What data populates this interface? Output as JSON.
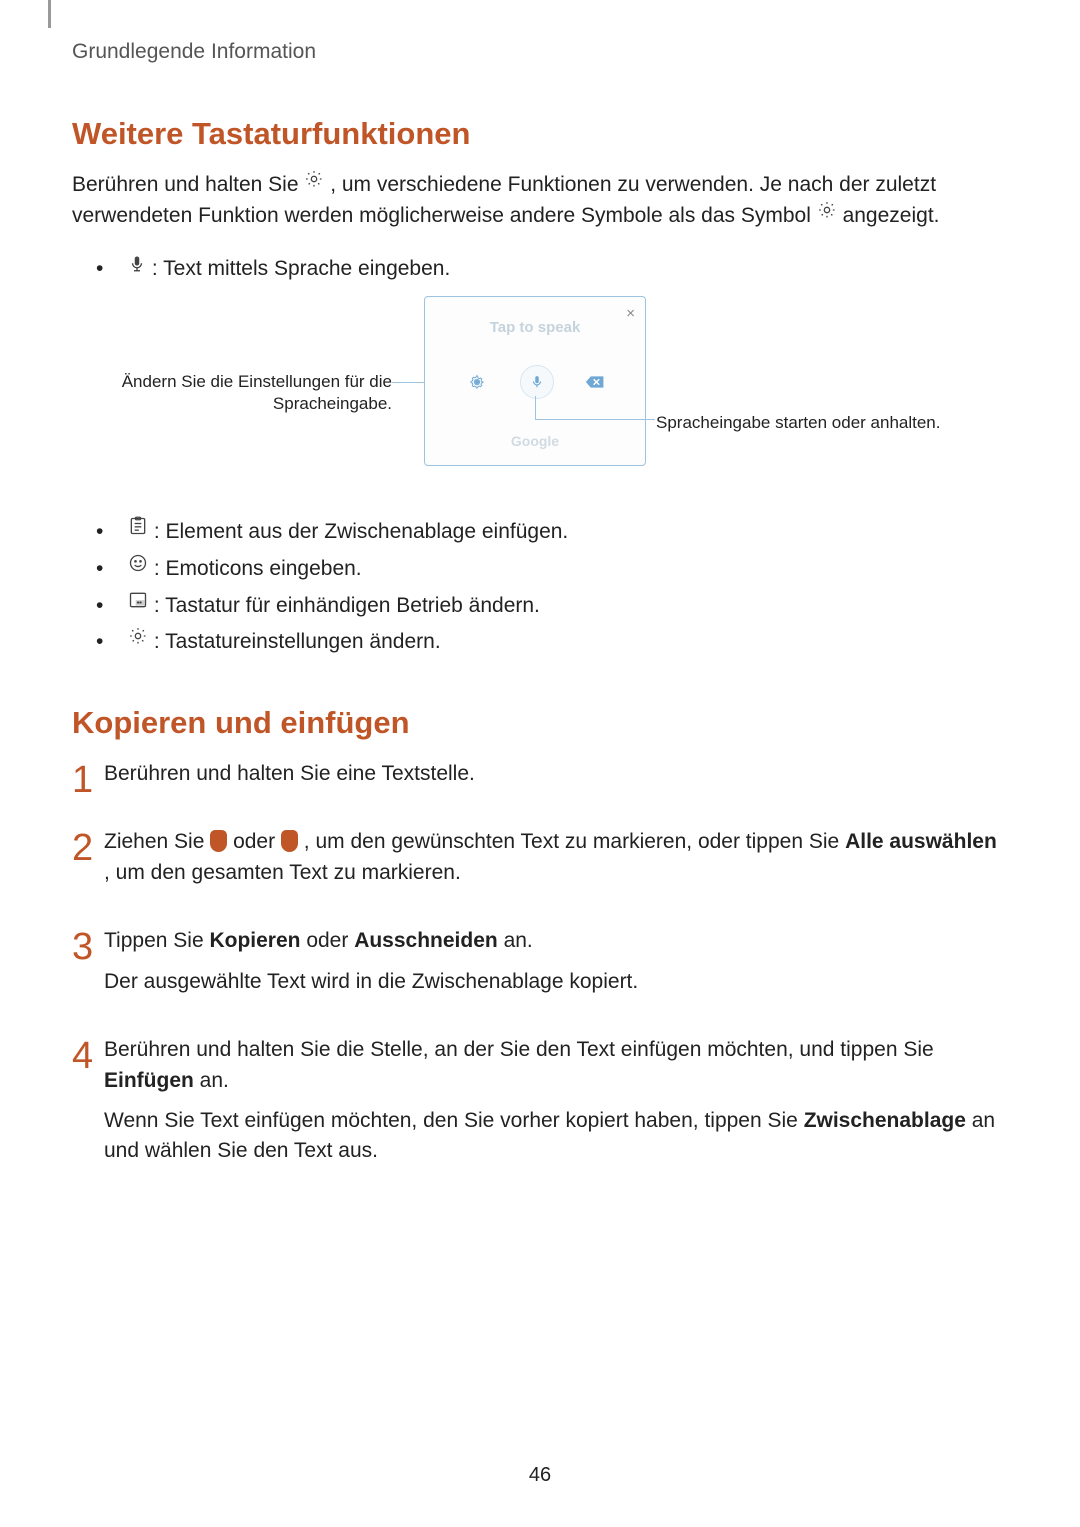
{
  "header": "Grundlegende Information",
  "s1": {
    "title": "Weitere Tastaturfunktionen",
    "intro_a": "Berühren und halten Sie ",
    "intro_b": ", um verschiedene Funktionen zu verwenden. Je nach der zuletzt verwendeten Funktion werden möglicherweise andere Symbole als das Symbol ",
    "intro_c": " angezeigt.",
    "bullets_top": [
      " : Text mittels Sprache eingeben."
    ],
    "figure": {
      "left_caption": "Ändern Sie die Einstellungen für die Spracheingabe.",
      "right_caption": "Spracheingabe starten oder anhalten.",
      "panel_tap": "Tap to speak",
      "panel_brand": "Google"
    },
    "bullets_bottom": [
      " : Element aus der Zwischenablage einfügen.",
      " : Emoticons eingeben.",
      " : Tastatur für einhändigen Betrieb ändern.",
      " : Tastatureinstellungen ändern."
    ]
  },
  "s2": {
    "title": "Kopieren und einfügen",
    "steps": {
      "1": {
        "text": "Berühren und halten Sie eine Textstelle."
      },
      "2": {
        "pre": "Ziehen Sie ",
        "mid": " oder ",
        "post_a": ", um den gewünschten Text zu markieren, oder tippen Sie ",
        "bold_a": "Alle auswählen",
        "post_b": ", um den gesamten Text zu markieren."
      },
      "3": {
        "pre": "Tippen Sie ",
        "bold_a": "Kopieren",
        "mid": " oder ",
        "bold_b": "Ausschneiden",
        "post": " an.",
        "note": "Der ausgewählte Text wird in die Zwischenablage kopiert."
      },
      "4": {
        "pre": "Berühren und halten Sie die Stelle, an der Sie den Text einfügen möchten, und tippen Sie ",
        "bold_a": "Einfügen",
        "post": " an.",
        "note_a": "Wenn Sie Text einfügen möchten, den Sie vorher kopiert haben, tippen Sie ",
        "note_bold": "Zwischenablage",
        "note_b": " an und wählen Sie den Text aus."
      }
    }
  },
  "page_number": "46"
}
